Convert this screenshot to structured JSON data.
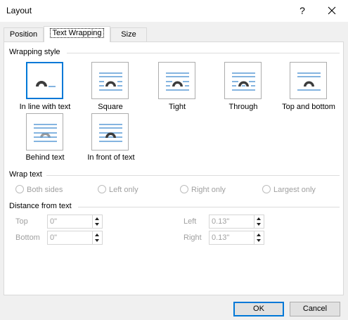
{
  "window": {
    "title": "Layout",
    "help_label": "?",
    "close_label": "✕"
  },
  "tabs": [
    {
      "label": "Position",
      "active": false
    },
    {
      "label": "Text Wrapping",
      "active": true
    },
    {
      "label": "Size",
      "active": false
    }
  ],
  "wrapping_style": {
    "label": "Wrapping style",
    "selected": "in-line-with-text",
    "options": [
      {
        "id": "in-line-with-text",
        "label": "In line with text",
        "icon": "inline-icon"
      },
      {
        "id": "square",
        "label": "Square",
        "icon": "square-wrap-icon"
      },
      {
        "id": "tight",
        "label": "Tight",
        "icon": "tight-wrap-icon"
      },
      {
        "id": "through",
        "label": "Through",
        "icon": "through-wrap-icon"
      },
      {
        "id": "top-and-bottom",
        "label": "Top and bottom",
        "icon": "top-bottom-wrap-icon"
      },
      {
        "id": "behind-text",
        "label": "Behind text",
        "icon": "behind-text-icon"
      },
      {
        "id": "in-front-of-text",
        "label": "In front of text",
        "icon": "in-front-text-icon"
      }
    ]
  },
  "wrap_text": {
    "label": "Wrap text",
    "options": [
      "Both sides",
      "Left only",
      "Right only",
      "Largest only"
    ]
  },
  "distance": {
    "label": "Distance from text",
    "top_label": "Top",
    "top_value": "0\"",
    "bottom_label": "Bottom",
    "bottom_value": "0\"",
    "left_label": "Left",
    "left_value": "0.13\"",
    "right_label": "Right",
    "right_value": "0.13\""
  },
  "buttons": {
    "ok": "OK",
    "cancel": "Cancel"
  },
  "colors": {
    "accent": "#0078d7",
    "line_blue": "#5b9bd5",
    "shape_dark": "#3c3c3c"
  }
}
